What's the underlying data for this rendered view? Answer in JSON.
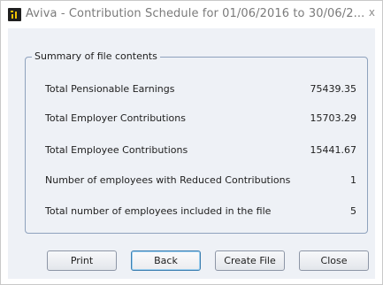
{
  "window": {
    "title": "Aviva - Contribution Schedule for 01/06/2016 to 30/06/2...",
    "close_glyph": "x"
  },
  "summary": {
    "legend": "Summary of file contents",
    "rows": [
      {
        "label": "Total Pensionable Earnings",
        "value": "75439.35"
      },
      {
        "label": "Total Employer Contributions",
        "value": "15703.29"
      },
      {
        "label": "Total Employee Contributions",
        "value": "15441.67"
      },
      {
        "label": "Number of employees with Reduced Contributions",
        "value": "1"
      },
      {
        "label": "Total number of employees included in the file",
        "value": "5"
      }
    ]
  },
  "buttons": {
    "print": "Print",
    "back": "Back",
    "create_file": "Create File",
    "close": "Close"
  },
  "icons": {
    "app": "aviva-app-icon",
    "close": "close-icon"
  }
}
